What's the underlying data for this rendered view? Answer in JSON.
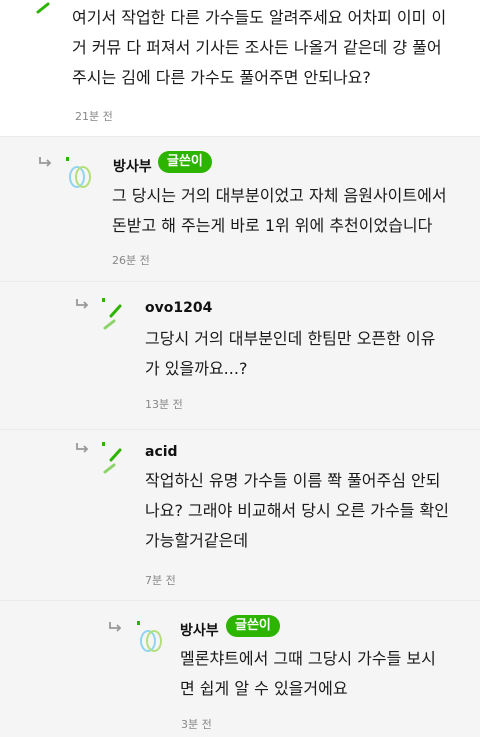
{
  "comments": [
    {
      "lines": [
        "여기서 작업한 다른 가수들도 알려주세요 어차피 이미 이",
        "거 커뮤 다 퍼져서 기사든 조사든 나올거 같은데 걍 풀어",
        "주시는 김에 다른 가수도 풀어주면 안되나요?"
      ],
      "time": "21분 전"
    },
    {
      "nick": "방사부",
      "badge": "글쓴이",
      "lines": [
        "그 당시는 거의 대부분이었고 자체 음원사이트에서",
        "돈받고 해 주는게 바로 1위 위에 추천이었습니다"
      ],
      "time": "26분 전"
    },
    {
      "nick": "ovo1204",
      "lines": [
        "그당시 거의 대부분인데 한팀만 오픈한 이유",
        "가 있을까요...?"
      ],
      "time": "13분 전"
    },
    {
      "nick": "acid",
      "lines": [
        "작업하신 유명 가수들 이름 쫙 풀어주심 안되",
        "나요? 그래야 비교해서 당시 오른 가수들 확인",
        "가능할거같은데"
      ],
      "time": "7분 전"
    },
    {
      "nick": "방사부",
      "badge": "글쓴이",
      "lines": [
        "멜론챠트에서 그때 그당시 가수들 보시",
        "면 쉽게 알 수 있을거에요"
      ],
      "time": "3분 전"
    }
  ],
  "colors": {
    "accent": "#2db400",
    "shaded_bg": "#f5f5f5",
    "time": "#888888"
  },
  "icons": [
    "reply-arrow-icon",
    "leaf-avatar-icon",
    "ring-avatar-icon"
  ]
}
